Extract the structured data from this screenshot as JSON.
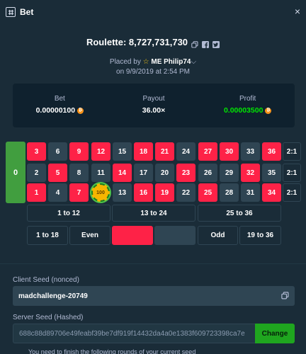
{
  "modal": {
    "title": "Bet",
    "close_glyph": "×",
    "icons": {
      "header": "bet-slip-icon",
      "close": "close-icon"
    }
  },
  "game": {
    "title": "Roulette: 8,727,731,730",
    "icons": [
      "copy-icon",
      "facebook-icon",
      "twitter-icon"
    ]
  },
  "placed": {
    "prefix": "Placed by",
    "star_glyph": "☆",
    "username": "ME Philip74",
    "dropdown_glyph": "⌵",
    "datetime": "on 9/9/2019 at 2:54 PM"
  },
  "stats": {
    "bet": {
      "label": "Bet",
      "value": "0.00000100"
    },
    "payout": {
      "label": "Payout",
      "value": "36.00×"
    },
    "profit": {
      "label": "Profit",
      "value": "0.00003500"
    },
    "currency_glyph": "₿",
    "colors": {
      "profit": "#00e701",
      "currency": "#f7931a"
    }
  },
  "board": {
    "zero": "0",
    "rows": [
      [
        {
          "n": "3",
          "c": "red"
        },
        {
          "n": "6",
          "c": "black"
        },
        {
          "n": "9",
          "c": "red"
        },
        {
          "n": "12",
          "c": "red"
        },
        {
          "n": "15",
          "c": "black"
        },
        {
          "n": "18",
          "c": "red"
        },
        {
          "n": "21",
          "c": "red"
        },
        {
          "n": "24",
          "c": "black"
        },
        {
          "n": "27",
          "c": "red"
        },
        {
          "n": "30",
          "c": "red"
        },
        {
          "n": "33",
          "c": "black"
        },
        {
          "n": "36",
          "c": "red"
        }
      ],
      [
        {
          "n": "2",
          "c": "black"
        },
        {
          "n": "5",
          "c": "red"
        },
        {
          "n": "8",
          "c": "black"
        },
        {
          "n": "11",
          "c": "black"
        },
        {
          "n": "14",
          "c": "red"
        },
        {
          "n": "17",
          "c": "black"
        },
        {
          "n": "20",
          "c": "black"
        },
        {
          "n": "23",
          "c": "red"
        },
        {
          "n": "26",
          "c": "black"
        },
        {
          "n": "29",
          "c": "black"
        },
        {
          "n": "32",
          "c": "red"
        },
        {
          "n": "35",
          "c": "black"
        }
      ],
      [
        {
          "n": "1",
          "c": "red"
        },
        {
          "n": "4",
          "c": "black"
        },
        {
          "n": "7",
          "c": "red"
        },
        {
          "n": "",
          "c": "chip"
        },
        {
          "n": "13",
          "c": "black"
        },
        {
          "n": "16",
          "c": "red"
        },
        {
          "n": "19",
          "c": "red"
        },
        {
          "n": "22",
          "c": "black"
        },
        {
          "n": "25",
          "c": "red"
        },
        {
          "n": "28",
          "c": "black"
        },
        {
          "n": "31",
          "c": "black"
        },
        {
          "n": "34",
          "c": "red"
        }
      ]
    ],
    "column_bets": [
      "2:1",
      "2:1",
      "2:1"
    ],
    "chip": {
      "label": "100",
      "color": "#f6b500"
    },
    "dozens": [
      "1 to 12",
      "13 to 24",
      "25 to 36"
    ],
    "outside": [
      {
        "label": "1 to 18",
        "style": "outline"
      },
      {
        "label": "Even",
        "style": "outline"
      },
      {
        "label": "",
        "style": "red"
      },
      {
        "label": "",
        "style": "black"
      },
      {
        "label": "Odd",
        "style": "outline"
      },
      {
        "label": "19 to 36",
        "style": "outline"
      }
    ],
    "colors": {
      "red": "#fe2247",
      "black": "#2f4553",
      "zero": "#419e3f"
    }
  },
  "fairness": {
    "client_seed_label": "Client Seed (nonced)",
    "client_seed_value": "madchallenge-20749",
    "server_seed_label": "Server Seed (Hashed)",
    "server_seed_value": "688c88d89706e49feabf39be7df919f14432da4a0e1383f609723398ca7e",
    "change_label": "Change",
    "footer": "You need to finish the following rounds of your current seed"
  }
}
